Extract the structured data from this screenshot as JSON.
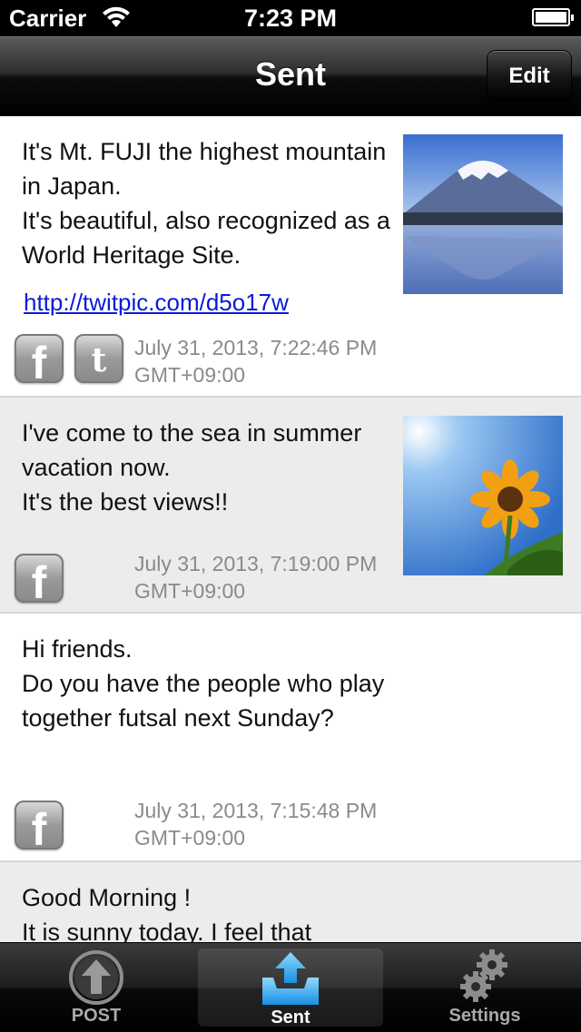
{
  "status_bar": {
    "carrier": "Carrier",
    "time": "7:23 PM"
  },
  "nav": {
    "title": "Sent",
    "edit_label": "Edit"
  },
  "posts": [
    {
      "text": "It's Mt. FUJI the highest mountain in Japan.\nIt's beautiful, also recognized as a World Heritage Site.",
      "link": "http://twitpic.com/d5o17w",
      "date": "July 31, 2013, 7:22:46 PM\nGMT+09:00",
      "services": [
        "facebook-icon",
        "twitter-icon"
      ],
      "photo": "mount-fuji-photo"
    },
    {
      "text": "I've come to the sea in summer vacation now.\nIt's the best views!!",
      "date": "July 31, 2013, 7:19:00 PM\nGMT+09:00",
      "services": [
        "facebook-icon"
      ],
      "photo": "sunflower-photo"
    },
    {
      "text": "Hi friends.\nDo you have the people who play together  futsal next Sunday?",
      "date": "July 31, 2013, 7:15:48 PM\nGMT+09:00",
      "services": [
        "facebook-icon"
      ]
    },
    {
      "text": "Good Morning !\nIt is sunny today. I feel that"
    }
  ],
  "tabs": [
    {
      "label": "POST",
      "icon": "upload-arrow-icon"
    },
    {
      "label": "Sent",
      "icon": "sent-tray-icon",
      "selected": true
    },
    {
      "label": "Settings",
      "icon": "gear-icon"
    }
  ],
  "colors": {
    "link": "#0a1ad8",
    "date": "#8a8a8a",
    "alt_row": "#ececec"
  }
}
